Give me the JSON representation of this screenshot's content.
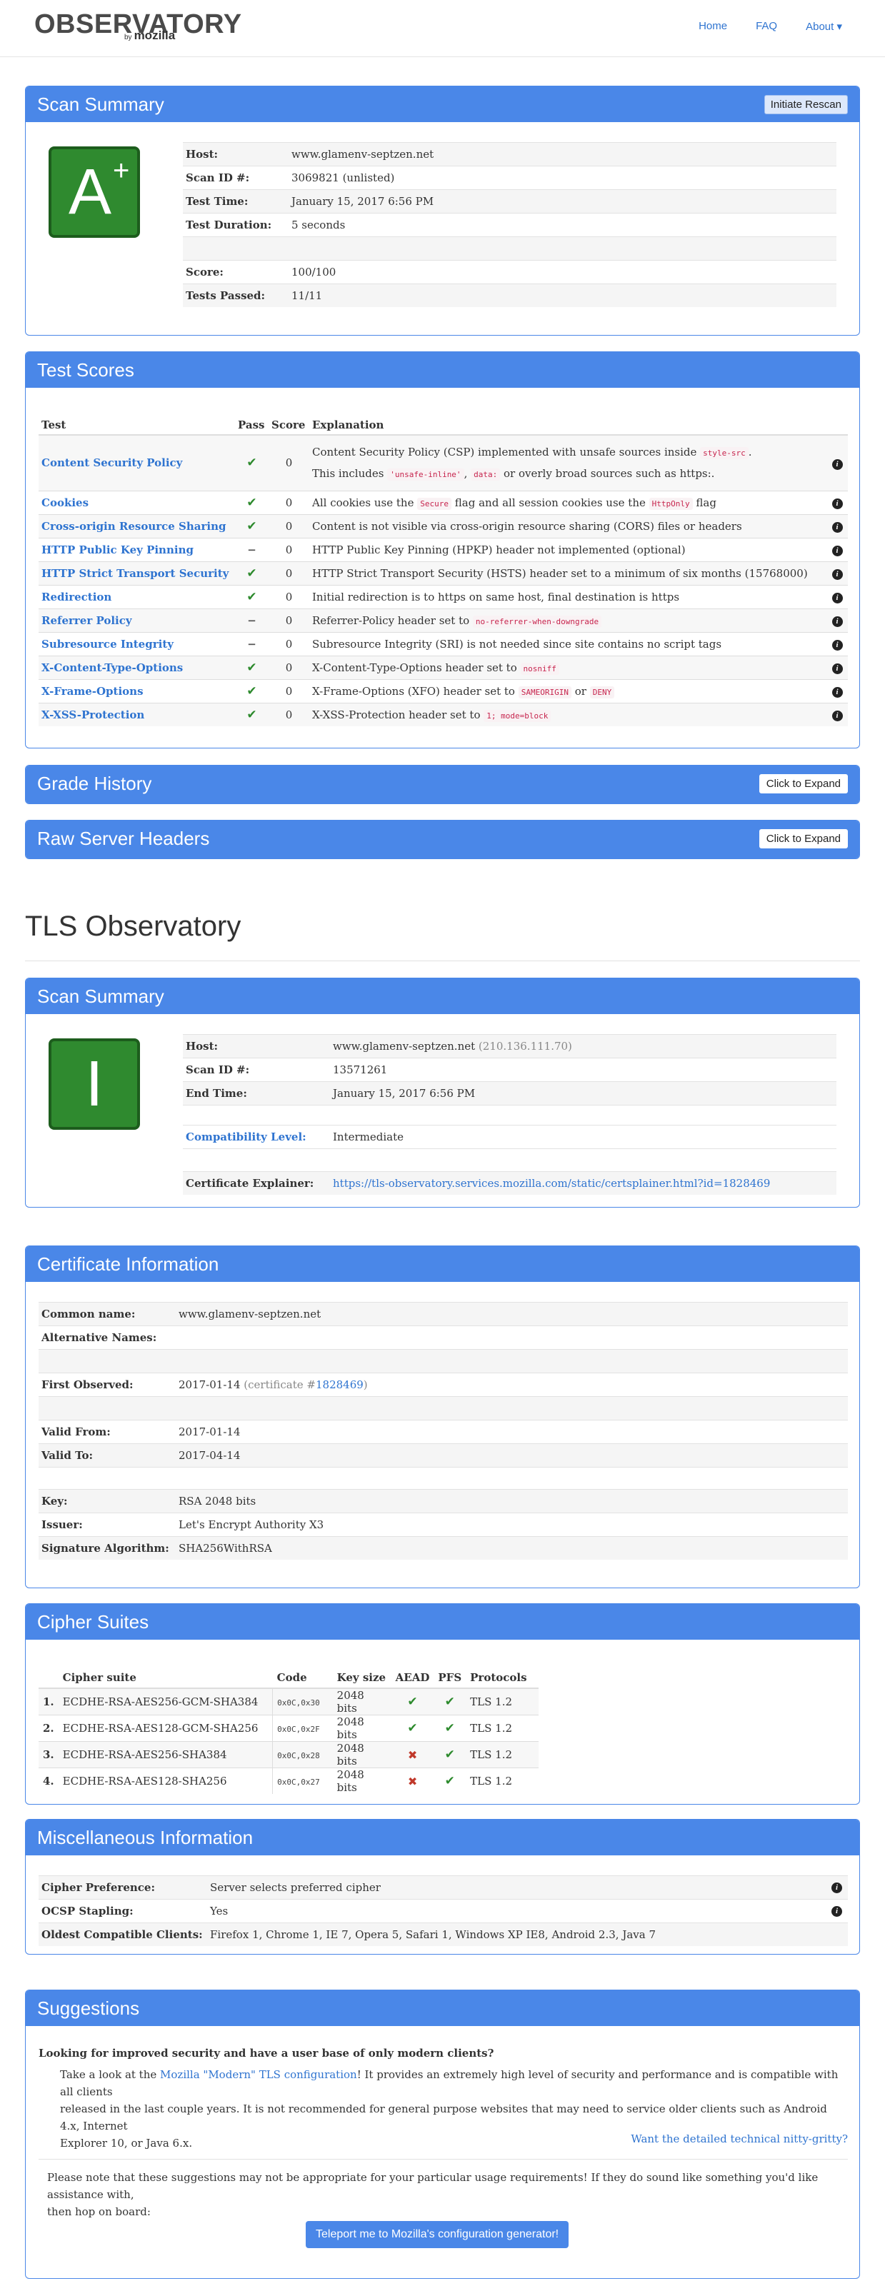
{
  "nav": {
    "logo": "OBSERVATORY",
    "logo_by": "by",
    "logo_sub": "mozilla",
    "home": "Home",
    "faq": "FAQ",
    "about": "About ▾"
  },
  "scan_summary": {
    "title": "Scan Summary",
    "rescan_button": "Initiate Rescan",
    "grade": "A",
    "grade_modifier": "+",
    "rows": [
      {
        "label": "Host:",
        "value": "www.glamenv-septzen.net"
      },
      {
        "label": "Scan ID #:",
        "value": "3069821 (unlisted)"
      },
      {
        "label": "Test Time:",
        "value": "January 15, 2017 6:56 PM"
      },
      {
        "label": "Test Duration:",
        "value": "5 seconds"
      },
      {
        "label": "",
        "value": ""
      },
      {
        "label": "Score:",
        "value": "100/100"
      },
      {
        "label": "Tests Passed:",
        "value": "11/11"
      }
    ]
  },
  "test_scores": {
    "title": "Test Scores",
    "headers": {
      "test": "Test",
      "pass": "Pass",
      "score": "Score",
      "explanation": "Explanation"
    },
    "csp": {
      "name": "Content Security Policy",
      "score": "0",
      "line1a": "Content Security Policy (CSP) implemented with unsafe sources inside",
      "line1_code": "style-src",
      "line1b": ".",
      "line2a": "This includes",
      "line2_code1": "'unsafe-inline'",
      "line2_sep": ",",
      "line2_code2": "data:",
      "line2b": "or overly broad sources such as https:."
    },
    "rows": [
      {
        "name": "Cookies",
        "pass": "check",
        "score": "0",
        "pre": "All cookies use the",
        "c1": "Secure",
        "mid": "flag and all session cookies use the",
        "c2": "HttpOnly",
        "post": "flag"
      },
      {
        "name": "Cross-origin Resource Sharing",
        "pass": "check",
        "score": "0",
        "pre": "Content is not visible via cross-origin resource sharing (CORS) files or headers",
        "c1": "",
        "mid": "",
        "c2": "",
        "post": ""
      },
      {
        "name": "HTTP Public Key Pinning",
        "pass": "dash",
        "score": "0",
        "pre": "HTTP Public Key Pinning (HPKP) header not implemented (optional)",
        "c1": "",
        "mid": "",
        "c2": "",
        "post": ""
      },
      {
        "name": "HTTP Strict Transport Security",
        "pass": "check",
        "score": "0",
        "pre": "HTTP Strict Transport Security (HSTS) header set to a minimum of six months (15768000)",
        "c1": "",
        "mid": "",
        "c2": "",
        "post": ""
      },
      {
        "name": "Redirection",
        "pass": "check",
        "score": "0",
        "pre": "Initial redirection is to https on same host, final destination is https",
        "c1": "",
        "mid": "",
        "c2": "",
        "post": ""
      },
      {
        "name": "Referrer Policy",
        "pass": "dash",
        "score": "0",
        "pre": "Referrer-Policy header set to",
        "c1": "no-referrer-when-downgrade",
        "mid": "",
        "c2": "",
        "post": ""
      },
      {
        "name": "Subresource Integrity",
        "pass": "dash",
        "score": "0",
        "pre": "Subresource Integrity (SRI) is not needed since site contains no script tags",
        "c1": "",
        "mid": "",
        "c2": "",
        "post": ""
      },
      {
        "name": "X-Content-Type-Options",
        "pass": "check",
        "score": "0",
        "pre": "X-Content-Type-Options header set to",
        "c1": "nosniff",
        "mid": "",
        "c2": "",
        "post": ""
      },
      {
        "name": "X-Frame-Options",
        "pass": "check",
        "score": "0",
        "pre": "X-Frame-Options (XFO) header set to",
        "c1": "SAMEORIGIN",
        "mid": "or",
        "c2": "DENY",
        "post": ""
      },
      {
        "name": "X-XSS-Protection",
        "pass": "check",
        "score": "0",
        "pre": "X-XSS-Protection header set to",
        "c1": "1; mode=block",
        "mid": "",
        "c2": "",
        "post": ""
      }
    ]
  },
  "grade_history": {
    "title": "Grade History",
    "button": "Click to Expand"
  },
  "raw_headers": {
    "title": "Raw Server Headers",
    "button": "Click to Expand"
  },
  "tls_title": "TLS Observatory",
  "tls_summary": {
    "title": "Scan Summary",
    "grade": "I",
    "host_label": "Host:",
    "host_value": "www.glamenv-septzen.net",
    "host_ip": "(210.136.111.70)",
    "scan_label": "Scan ID #:",
    "scan_value": "13571261",
    "end_label": "End Time:",
    "end_value": "January 15, 2017 6:56 PM",
    "compat_label": "Compatibility Level:",
    "compat_value": "Intermediate",
    "cert_label": "Certificate Explainer:",
    "cert_value": "https://tls-observatory.services.mozilla.com/static/certsplainer.html?id=1828469"
  },
  "cert_info": {
    "title": "Certificate Information",
    "common_label": "Common name:",
    "common_value": "www.glamenv-septzen.net",
    "alt_label": "Alternative Names:",
    "first_label": "First Observed:",
    "first_value": "2017-01-14",
    "first_paren_open": "(certificate #",
    "first_cert_id": "1828469",
    "first_paren_close": ")",
    "valid_from_label": "Valid From:",
    "valid_from_value": "2017-01-14",
    "valid_to_label": "Valid To:",
    "valid_to_value": "2017-04-14",
    "key_label": "Key:",
    "key_value": "RSA 2048 bits",
    "issuer_label": "Issuer:",
    "issuer_value": "Let's Encrypt Authority X3",
    "sig_label": "Signature Algorithm:",
    "sig_value": "SHA256WithRSA"
  },
  "ciphers": {
    "title": "Cipher Suites",
    "headers": {
      "suite": "Cipher suite",
      "code": "Code",
      "key": "Key size",
      "aead": "AEAD",
      "pfs": "PFS",
      "protocols": "Protocols"
    },
    "rows": [
      {
        "n": "1.",
        "suite": "ECDHE-RSA-AES256-GCM-SHA384",
        "code": "0x0C,0x30",
        "key": "2048 bits",
        "aead": "check",
        "pfs": "check",
        "proto": "TLS 1.2"
      },
      {
        "n": "2.",
        "suite": "ECDHE-RSA-AES128-GCM-SHA256",
        "code": "0x0C,0x2F",
        "key": "2048 bits",
        "aead": "check",
        "pfs": "check",
        "proto": "TLS 1.2"
      },
      {
        "n": "3.",
        "suite": "ECDHE-RSA-AES256-SHA384",
        "code": "0x0C,0x28",
        "key": "2048 bits",
        "aead": "cross",
        "pfs": "check",
        "proto": "TLS 1.2"
      },
      {
        "n": "4.",
        "suite": "ECDHE-RSA-AES128-SHA256",
        "code": "0x0C,0x27",
        "key": "2048 bits",
        "aead": "cross",
        "pfs": "check",
        "proto": "TLS 1.2"
      }
    ]
  },
  "misc": {
    "title": "Miscellaneous Information",
    "pref_label": "Cipher Preference:",
    "pref_value": "Server selects preferred cipher",
    "ocsp_label": "OCSP Stapling:",
    "ocsp_value": "Yes",
    "oldest_label": "Oldest Compatible Clients:",
    "oldest_value": "Firefox 1, Chrome 1, IE 7, Opera 5, Safari 1, Windows XP IE8, Android 2.3, Java 7"
  },
  "suggestions": {
    "title": "Suggestions",
    "question": "Looking for improved security and have a user base of only modern clients?",
    "p1_pre": "Take a look at the",
    "p1_link": "Mozilla \"Modern\" TLS configuration",
    "p1_line1_post": "! It provides an extremely high level of security and performance and is compatible with all clients",
    "p1_line2": "released in the last couple years. It is not recommended for general purpose websites that may need to service older clients such as Android 4.x, Internet",
    "p1_line3": "Explorer 10, or Java 6.x.",
    "detail_link": "Want the detailed technical nitty-gritty?",
    "note_line1": "Please note that these suggestions may not be appropriate for your particular usage requirements! If they do sound like something you'd like assistance with,",
    "note_line2": "then hop on board:",
    "teleport_button": "Teleport me to Mozilla's configuration generator!"
  }
}
